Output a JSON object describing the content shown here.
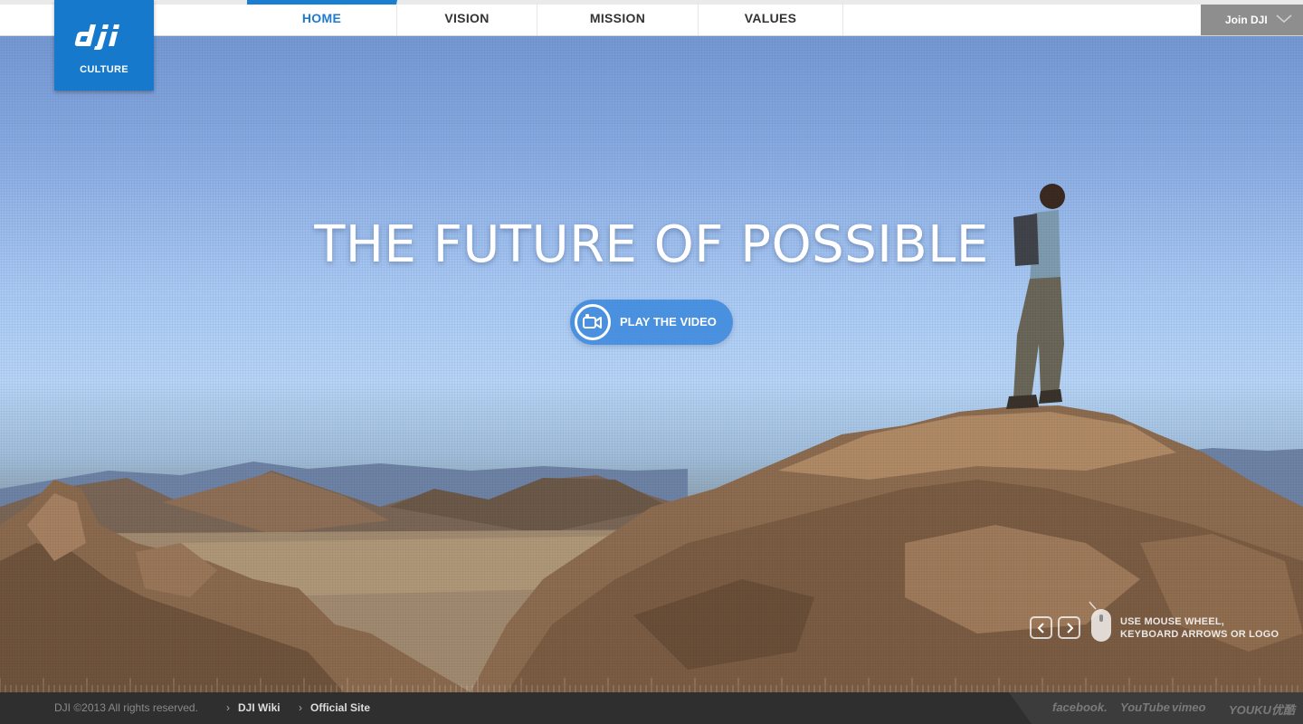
{
  "logo": {
    "wordmark": "dji",
    "subtitle": "CULTURE"
  },
  "nav": {
    "items": [
      {
        "label": "HOME",
        "active": true
      },
      {
        "label": "VISION",
        "active": false
      },
      {
        "label": "MISSION",
        "active": false
      },
      {
        "label": "VALUES",
        "active": false
      }
    ],
    "join_label": "Join DJI"
  },
  "hero": {
    "headline": "THE FUTURE OF POSSIBLE",
    "play_label": "PLAY THE VIDEO"
  },
  "hint": {
    "line1": "USE MOUSE WHEEL,",
    "line2": "KEYBOARD ARROWS OR LOGO"
  },
  "footer": {
    "copyright": "DJI ©2013 All rights reserved.",
    "links": [
      "DJI Wiki",
      "Official Site"
    ],
    "social": [
      "facebook.",
      "YouTube",
      "vimeo",
      "YOUKU优酷"
    ]
  },
  "colors": {
    "brand_blue": "#1679cb",
    "active_nav": "#1f7acb",
    "footer_bg": "#2f2f2f"
  }
}
